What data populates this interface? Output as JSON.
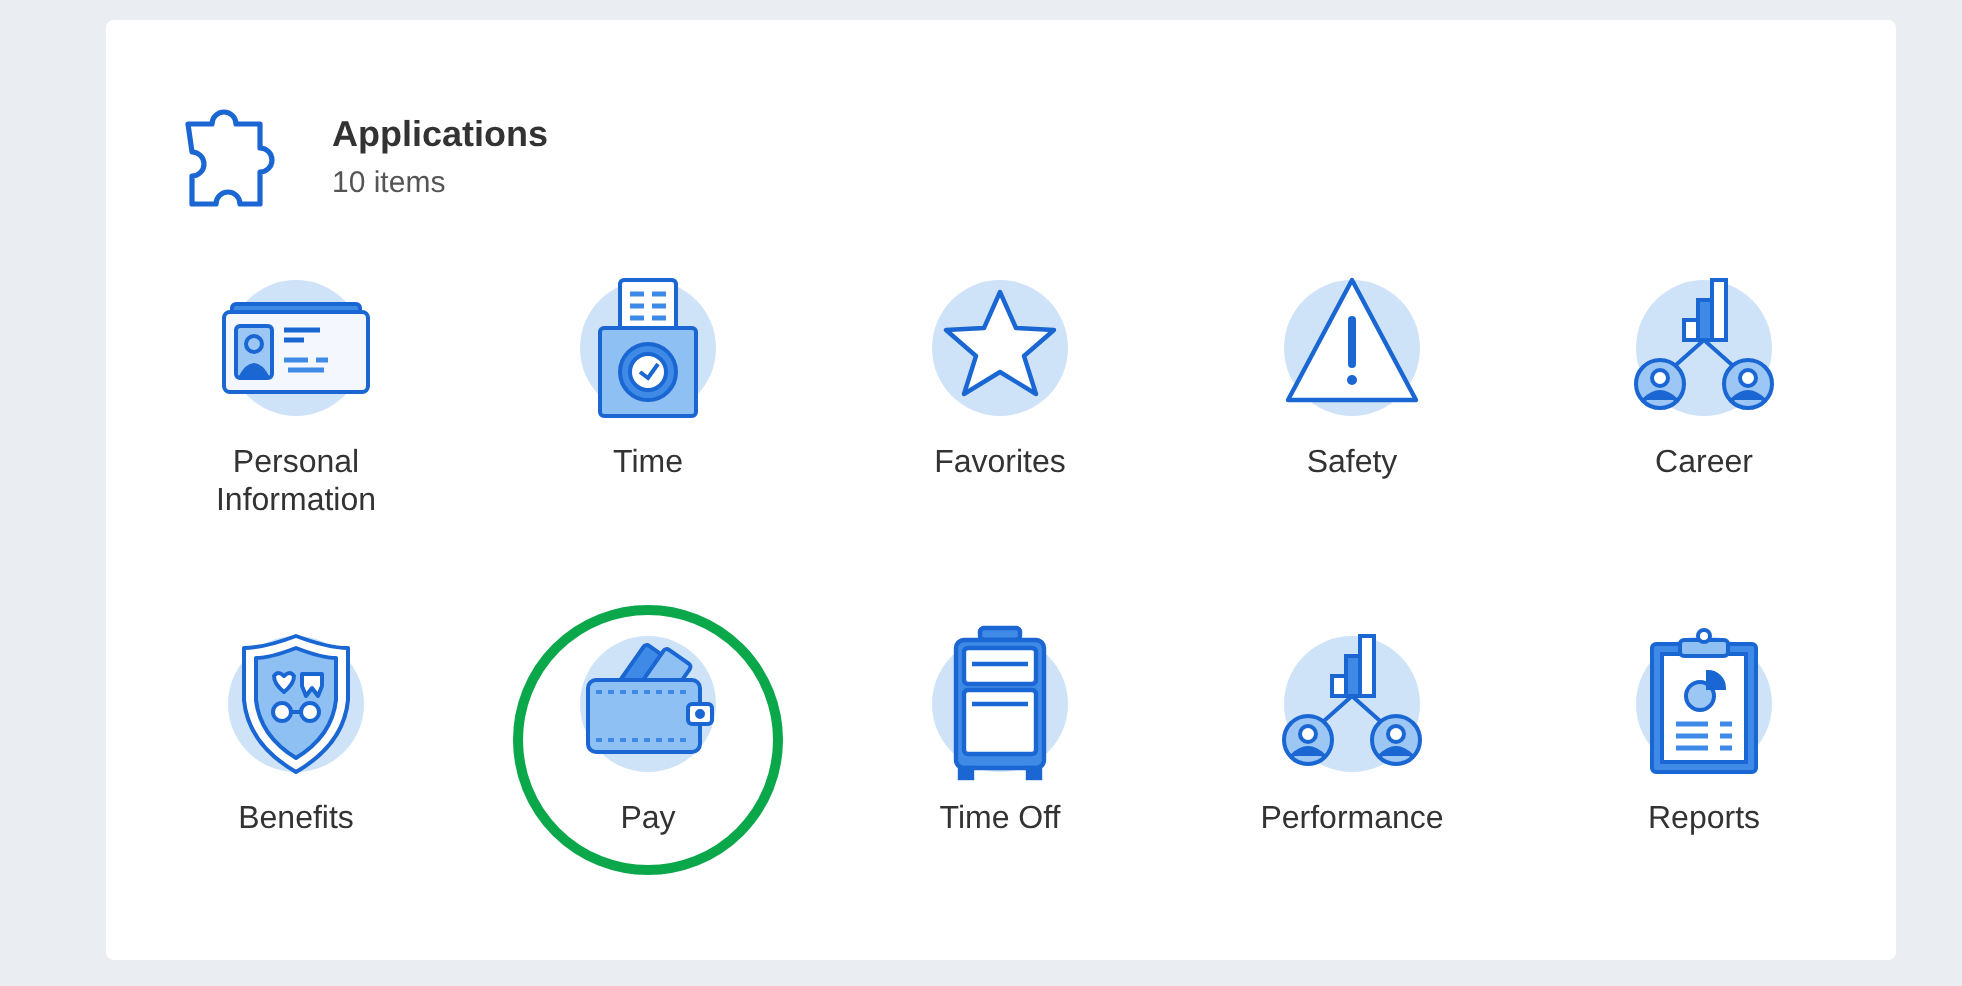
{
  "panel": {
    "title": "Applications",
    "subtitle": "10 items"
  },
  "apps": [
    {
      "label": "Personal Information",
      "highlighted": false
    },
    {
      "label": "Time",
      "highlighted": false
    },
    {
      "label": "Favorites",
      "highlighted": false
    },
    {
      "label": "Safety",
      "highlighted": false
    },
    {
      "label": "Career",
      "highlighted": false
    },
    {
      "label": "Benefits",
      "highlighted": false
    },
    {
      "label": "Pay",
      "highlighted": true
    },
    {
      "label": "Time Off",
      "highlighted": false
    },
    {
      "label": "Performance",
      "highlighted": false
    },
    {
      "label": "Reports",
      "highlighted": false
    }
  ]
}
